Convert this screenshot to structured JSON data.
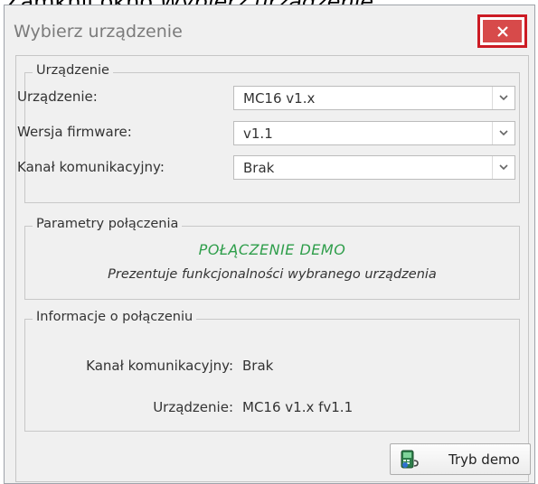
{
  "caption": {
    "prefix": "Zamknij okno ",
    "emphasis": "Wybierz urządzenie."
  },
  "window": {
    "title": "Wybierz urządzenie",
    "close_symbol": "×"
  },
  "device_group": {
    "legend": "Urządzenie",
    "fields": [
      {
        "label": "Urządzenie:",
        "value": "MC16 v1.x"
      },
      {
        "label": "Wersja firmware:",
        "value": "v1.1"
      },
      {
        "label": "Kanał komunikacyjny:",
        "value": "Brak"
      }
    ]
  },
  "connection_params": {
    "legend": "Parametry połączenia",
    "mode_title": "POŁĄCZENIE DEMO",
    "mode_description": "Prezentuje funkcjonalności wybranego urządzenia"
  },
  "connection_info": {
    "legend": "Informacje o połączeniu",
    "rows": [
      {
        "label": "Kanał komunikacyjny:",
        "value": "Brak"
      },
      {
        "label": "Urządzenie:",
        "value": "MC16 v1.x fv1.1"
      }
    ]
  },
  "buttons": {
    "demo_label": "Tryb demo"
  },
  "colors": {
    "close_button": "#d74a4a",
    "close_highlight": "#cc1b24",
    "demo_text": "#2f9e4b"
  },
  "icons": {
    "close": "close-icon",
    "dropdown": "chevron-down-icon",
    "demo": "device-demo-icon"
  }
}
